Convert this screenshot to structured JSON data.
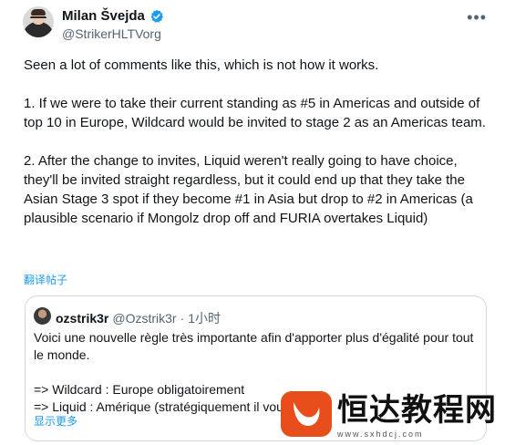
{
  "author": {
    "name": "Milan Švejda",
    "handle": "@StrikerHLTVorg"
  },
  "tweet": {
    "text": "Seen a lot of comments like this, which is not how it works.\n\n1. If we were to take their current standing as #5 in Americas and outside of top 10 in Europe, Wildcard would be invited to stage 2 as an Americas team.\n\n2. After the change to invites, Liquid weren't really going to have choice, they'll be invited straight regardless, but it could end up that they take the Asian Stage 3 spot if they become #1 in Asia but drop to #2 in Americas (a plausible scenario if Mongolz drop off and FURIA overtakes Liquid)",
    "translate_label": "翻译帖子"
  },
  "quote": {
    "name": "ozstrik3r",
    "handle": "@Ozstrik3r",
    "separator": "·",
    "time": "1小时",
    "text": "Voici une nouvelle règle très importante afin d'apporter plus d'égalité pour tout le monde.\n\n=> Wildcard : Europe obligatoirement\n=> Liquid : Amérique (stratégiquement il vou",
    "show_more": "显示更多"
  },
  "watermark": {
    "brand": "恒达教程网",
    "url": "www.sxhdcj.com"
  },
  "colors": {
    "link": "#1d9bf0",
    "verified": "#1d9bf0",
    "logo": "#e84e1b"
  }
}
